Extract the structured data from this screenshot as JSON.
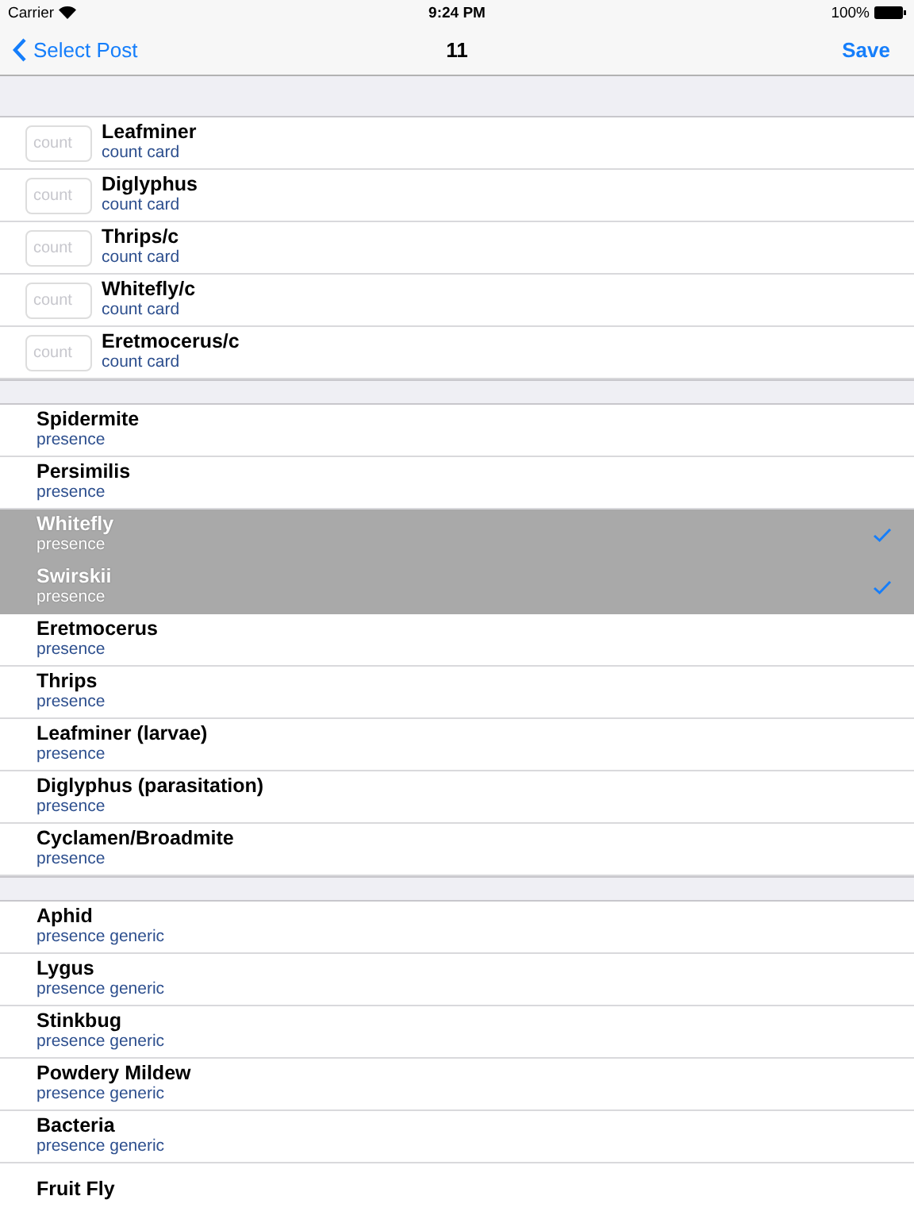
{
  "status_bar": {
    "carrier": "Carrier",
    "time": "9:24 PM",
    "battery": "100%"
  },
  "nav": {
    "back": "Select Post",
    "title": "11",
    "action": "Save"
  },
  "sections": [
    {
      "rows": [
        {
          "kind": "count",
          "placeholder": "count",
          "title": "Leafminer",
          "subtitle": "count card"
        },
        {
          "kind": "count",
          "placeholder": "count",
          "title": "Diglyphus",
          "subtitle": "count card"
        },
        {
          "kind": "count",
          "placeholder": "count",
          "title": "Thrips/c",
          "subtitle": "count card"
        },
        {
          "kind": "count",
          "placeholder": "count",
          "title": "Whitefly/c",
          "subtitle": "count card"
        },
        {
          "kind": "count",
          "placeholder": "count",
          "title": "Eretmocerus/c",
          "subtitle": "count card"
        }
      ]
    },
    {
      "rows": [
        {
          "kind": "check",
          "title": "Spidermite",
          "subtitle": "presence",
          "selected": false
        },
        {
          "kind": "check",
          "title": "Persimilis",
          "subtitle": "presence",
          "selected": false
        },
        {
          "kind": "check",
          "title": "Whitefly",
          "subtitle": "presence",
          "selected": true
        },
        {
          "kind": "check",
          "title": "Swirskii",
          "subtitle": "presence",
          "selected": true
        },
        {
          "kind": "check",
          "title": "Eretmocerus",
          "subtitle": "presence",
          "selected": false
        },
        {
          "kind": "check",
          "title": "Thrips",
          "subtitle": "presence",
          "selected": false
        },
        {
          "kind": "check",
          "title": "Leafminer (larvae)",
          "subtitle": "presence",
          "selected": false
        },
        {
          "kind": "check",
          "title": "Diglyphus (parasitation)",
          "subtitle": "presence",
          "selected": false
        },
        {
          "kind": "check",
          "title": "Cyclamen/Broadmite",
          "subtitle": "presence",
          "selected": false
        }
      ]
    },
    {
      "rows": [
        {
          "kind": "check",
          "title": "Aphid",
          "subtitle": "presence generic",
          "selected": false
        },
        {
          "kind": "check",
          "title": "Lygus",
          "subtitle": "presence generic",
          "selected": false
        },
        {
          "kind": "check",
          "title": "Stinkbug",
          "subtitle": "presence generic",
          "selected": false
        },
        {
          "kind": "check",
          "title": "Powdery Mildew",
          "subtitle": "presence generic",
          "selected": false
        },
        {
          "kind": "check",
          "title": "Bacteria",
          "subtitle": "presence generic",
          "selected": false
        },
        {
          "kind": "check",
          "title": "Fruit Fly",
          "selected": false
        }
      ]
    }
  ]
}
